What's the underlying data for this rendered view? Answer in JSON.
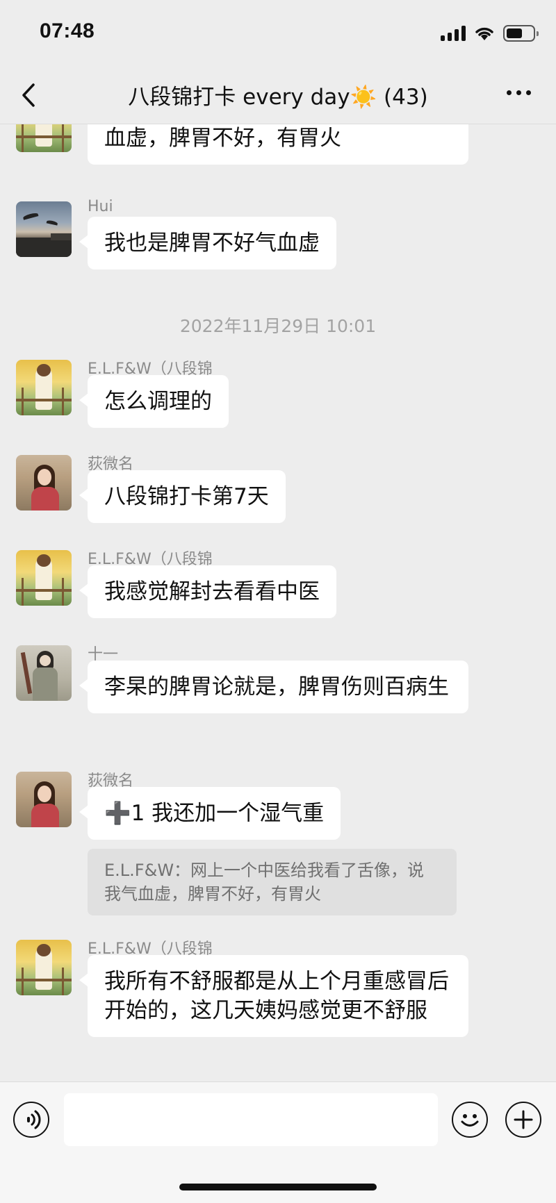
{
  "status_bar": {
    "time": "07:48"
  },
  "header": {
    "title": "八段锦打卡 every day☀️ (43)"
  },
  "messages": [
    {
      "sender": "",
      "text": "网上一个中医给我看了舌像，说我气血虚，脾胃不好，有胃火",
      "avatar": "elf-avatar"
    },
    {
      "sender": "Hui",
      "text": "我也是脾胃不好气血虚",
      "avatar": "bird-avatar"
    },
    {
      "timestamp": "2022年11月29日 10:01"
    },
    {
      "sender": "E.L.F&W（八段锦",
      "text": "怎么调理的",
      "avatar": "elf-avatar"
    },
    {
      "sender": "荻微名",
      "text": "八段锦打卡第7天",
      "avatar": "di-avatar"
    },
    {
      "sender": "E.L.F&W（八段锦",
      "text": "我感觉解封去看看中医",
      "avatar": "elf-avatar"
    },
    {
      "sender": "十一",
      "text": "李杲的脾胃论就是，脾胃伤则百病生",
      "avatar": "shiyi-avatar"
    },
    {
      "sender": "荻微名",
      "text": "➕1 我还加一个湿气重",
      "avatar": "di-avatar",
      "quote": "E.L.F&W：网上一个中医给我看了舌像，说我气血虚，脾胃不好，有胃火"
    },
    {
      "sender": "E.L.F&W（八段锦",
      "text": "我所有不舒服都是从上个月重感冒后开始的，这几天姨妈感觉更不舒服",
      "avatar": "elf-avatar"
    }
  ],
  "input_bar": {
    "placeholder": ""
  }
}
